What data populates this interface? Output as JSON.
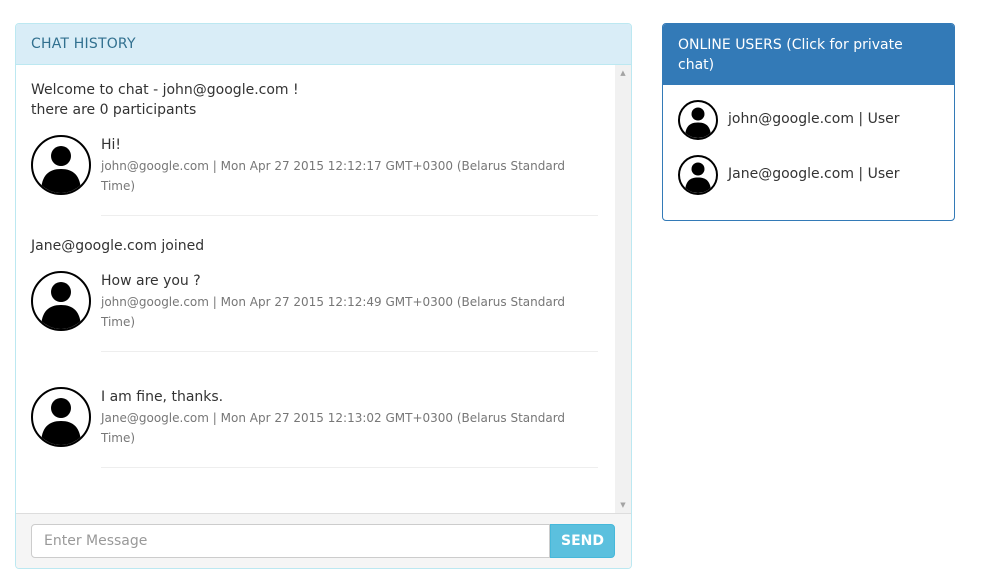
{
  "chat": {
    "heading": "CHAT HISTORY",
    "welcome_line1": "Welcome to chat - john@google.com !",
    "welcome_line2": "there are 0 participants",
    "joined_text": "Jane@google.com joined",
    "messages": [
      {
        "text": "Hi!",
        "meta": "john@google.com | Mon Apr 27 2015 12:12:17 GMT+0300 (Belarus Standard Time)",
        "avatar_icon": "user-silhouette-icon"
      },
      {
        "text": "How are you ?",
        "meta": "john@google.com | Mon Apr 27 2015 12:12:49 GMT+0300 (Belarus Standard Time)",
        "avatar_icon": "user-silhouette-icon"
      },
      {
        "text": "I am fine, thanks.",
        "meta": "Jane@google.com | Mon Apr 27 2015 12:13:02 GMT+0300 (Belarus Standard Time)",
        "avatar_icon": "user-silhouette-icon"
      }
    ],
    "input_placeholder": "Enter Message",
    "input_value": "",
    "send_label": "SEND"
  },
  "users": {
    "heading": "ONLINE USERS (Click for private chat)",
    "list": [
      {
        "label": "john@google.com | User",
        "avatar_icon": "user-silhouette-icon"
      },
      {
        "label": "Jane@google.com | User",
        "avatar_icon": "user-silhouette-icon"
      }
    ]
  },
  "colors": {
    "chat_heading_bg": "#d9edf7",
    "chat_heading_text": "#31708f",
    "users_heading_bg": "#337ab7",
    "send_button_bg": "#5bc0de"
  }
}
